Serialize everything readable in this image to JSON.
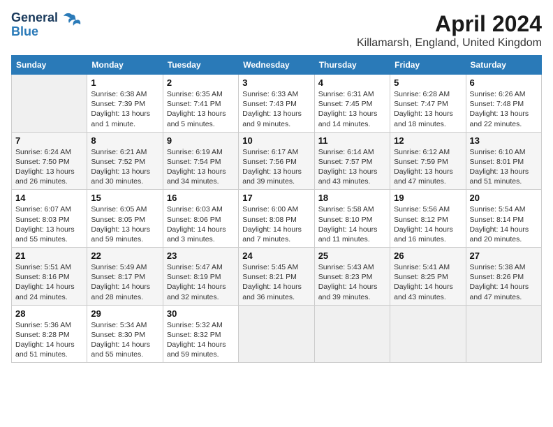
{
  "header": {
    "logo_line1": "General",
    "logo_line2": "Blue",
    "month_year": "April 2024",
    "location": "Killamarsh, England, United Kingdom"
  },
  "days_of_week": [
    "Sunday",
    "Monday",
    "Tuesday",
    "Wednesday",
    "Thursday",
    "Friday",
    "Saturday"
  ],
  "weeks": [
    [
      {
        "day": "",
        "info": ""
      },
      {
        "day": "1",
        "info": "Sunrise: 6:38 AM\nSunset: 7:39 PM\nDaylight: 13 hours\nand 1 minute."
      },
      {
        "day": "2",
        "info": "Sunrise: 6:35 AM\nSunset: 7:41 PM\nDaylight: 13 hours\nand 5 minutes."
      },
      {
        "day": "3",
        "info": "Sunrise: 6:33 AM\nSunset: 7:43 PM\nDaylight: 13 hours\nand 9 minutes."
      },
      {
        "day": "4",
        "info": "Sunrise: 6:31 AM\nSunset: 7:45 PM\nDaylight: 13 hours\nand 14 minutes."
      },
      {
        "day": "5",
        "info": "Sunrise: 6:28 AM\nSunset: 7:47 PM\nDaylight: 13 hours\nand 18 minutes."
      },
      {
        "day": "6",
        "info": "Sunrise: 6:26 AM\nSunset: 7:48 PM\nDaylight: 13 hours\nand 22 minutes."
      }
    ],
    [
      {
        "day": "7",
        "info": "Sunrise: 6:24 AM\nSunset: 7:50 PM\nDaylight: 13 hours\nand 26 minutes."
      },
      {
        "day": "8",
        "info": "Sunrise: 6:21 AM\nSunset: 7:52 PM\nDaylight: 13 hours\nand 30 minutes."
      },
      {
        "day": "9",
        "info": "Sunrise: 6:19 AM\nSunset: 7:54 PM\nDaylight: 13 hours\nand 34 minutes."
      },
      {
        "day": "10",
        "info": "Sunrise: 6:17 AM\nSunset: 7:56 PM\nDaylight: 13 hours\nand 39 minutes."
      },
      {
        "day": "11",
        "info": "Sunrise: 6:14 AM\nSunset: 7:57 PM\nDaylight: 13 hours\nand 43 minutes."
      },
      {
        "day": "12",
        "info": "Sunrise: 6:12 AM\nSunset: 7:59 PM\nDaylight: 13 hours\nand 47 minutes."
      },
      {
        "day": "13",
        "info": "Sunrise: 6:10 AM\nSunset: 8:01 PM\nDaylight: 13 hours\nand 51 minutes."
      }
    ],
    [
      {
        "day": "14",
        "info": "Sunrise: 6:07 AM\nSunset: 8:03 PM\nDaylight: 13 hours\nand 55 minutes."
      },
      {
        "day": "15",
        "info": "Sunrise: 6:05 AM\nSunset: 8:05 PM\nDaylight: 13 hours\nand 59 minutes."
      },
      {
        "day": "16",
        "info": "Sunrise: 6:03 AM\nSunset: 8:06 PM\nDaylight: 14 hours\nand 3 minutes."
      },
      {
        "day": "17",
        "info": "Sunrise: 6:00 AM\nSunset: 8:08 PM\nDaylight: 14 hours\nand 7 minutes."
      },
      {
        "day": "18",
        "info": "Sunrise: 5:58 AM\nSunset: 8:10 PM\nDaylight: 14 hours\nand 11 minutes."
      },
      {
        "day": "19",
        "info": "Sunrise: 5:56 AM\nSunset: 8:12 PM\nDaylight: 14 hours\nand 16 minutes."
      },
      {
        "day": "20",
        "info": "Sunrise: 5:54 AM\nSunset: 8:14 PM\nDaylight: 14 hours\nand 20 minutes."
      }
    ],
    [
      {
        "day": "21",
        "info": "Sunrise: 5:51 AM\nSunset: 8:16 PM\nDaylight: 14 hours\nand 24 minutes."
      },
      {
        "day": "22",
        "info": "Sunrise: 5:49 AM\nSunset: 8:17 PM\nDaylight: 14 hours\nand 28 minutes."
      },
      {
        "day": "23",
        "info": "Sunrise: 5:47 AM\nSunset: 8:19 PM\nDaylight: 14 hours\nand 32 minutes."
      },
      {
        "day": "24",
        "info": "Sunrise: 5:45 AM\nSunset: 8:21 PM\nDaylight: 14 hours\nand 36 minutes."
      },
      {
        "day": "25",
        "info": "Sunrise: 5:43 AM\nSunset: 8:23 PM\nDaylight: 14 hours\nand 39 minutes."
      },
      {
        "day": "26",
        "info": "Sunrise: 5:41 AM\nSunset: 8:25 PM\nDaylight: 14 hours\nand 43 minutes."
      },
      {
        "day": "27",
        "info": "Sunrise: 5:38 AM\nSunset: 8:26 PM\nDaylight: 14 hours\nand 47 minutes."
      }
    ],
    [
      {
        "day": "28",
        "info": "Sunrise: 5:36 AM\nSunset: 8:28 PM\nDaylight: 14 hours\nand 51 minutes."
      },
      {
        "day": "29",
        "info": "Sunrise: 5:34 AM\nSunset: 8:30 PM\nDaylight: 14 hours\nand 55 minutes."
      },
      {
        "day": "30",
        "info": "Sunrise: 5:32 AM\nSunset: 8:32 PM\nDaylight: 14 hours\nand 59 minutes."
      },
      {
        "day": "",
        "info": ""
      },
      {
        "day": "",
        "info": ""
      },
      {
        "day": "",
        "info": ""
      },
      {
        "day": "",
        "info": ""
      }
    ]
  ]
}
